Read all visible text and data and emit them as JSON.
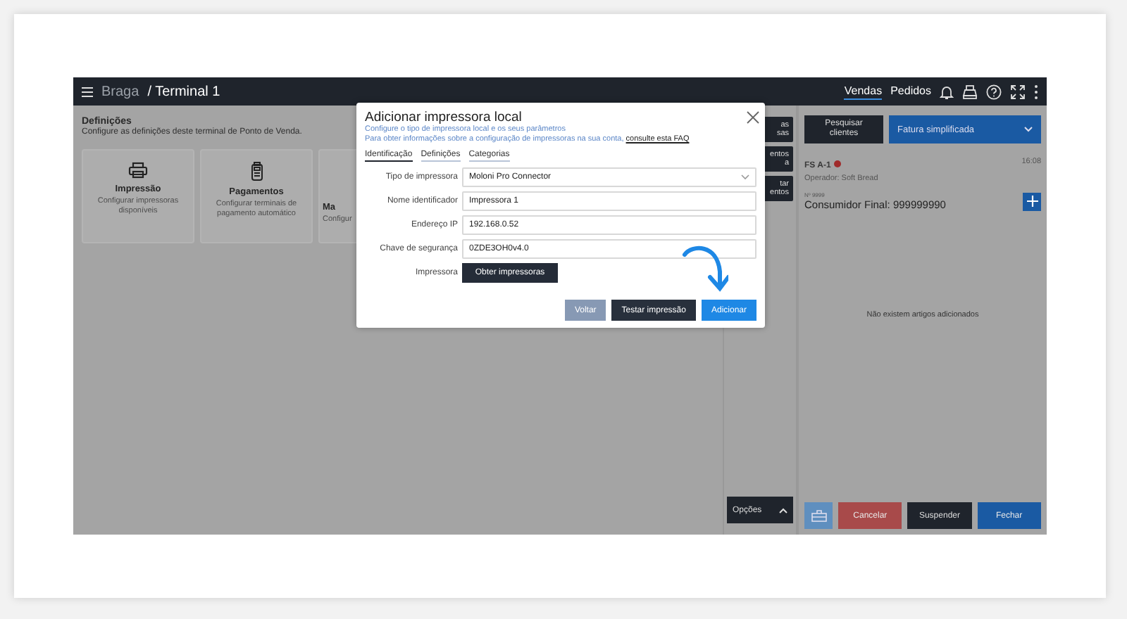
{
  "topbar": {
    "store": "Braga",
    "terminal": "/ Terminal 1",
    "nav": [
      {
        "label": "Vendas",
        "selected": true
      },
      {
        "label": "Pedidos",
        "selected": false
      }
    ]
  },
  "settings": {
    "title": "Definições",
    "subtitle": "Configure as definições deste terminal de Ponto de Venda.",
    "cards": [
      {
        "kind": "printer",
        "title": "Impressão",
        "text": "Configurar impressoras disponíveis"
      },
      {
        "kind": "payment",
        "title": "Pagamentos",
        "text": "Configurar terminais de pagamento automático"
      },
      {
        "kind": "partial",
        "title": "Ma",
        "text": "Configur"
      }
    ]
  },
  "side_buttons": [
    {
      "line1": "as",
      "line2": "sas"
    },
    {
      "line1": "entos",
      "line2": "a"
    },
    {
      "line1": "tar",
      "line2": "entos"
    }
  ],
  "options_button": "Opções",
  "sale": {
    "search_button": "Pesquisar clientes",
    "doc_type": "Fatura simplificada",
    "doc_number": "FS A-1",
    "time": "16:08",
    "operator": "Operador: Soft Bread",
    "nif_label": "Nº 9999",
    "customer": "Consumidor Final: 999999990",
    "empty": "Não existem artigos adicionados",
    "buttons": [
      {
        "kind": "drawer"
      },
      {
        "kind": "cancel",
        "label": "Cancelar"
      },
      {
        "kind": "dark",
        "label": "Suspender"
      },
      {
        "kind": "primary",
        "label": "Fechar"
      }
    ]
  },
  "modal": {
    "title": "Adicionar impressora local",
    "line1": "Configure o tipo de impressora local e os seus parâmetros",
    "line2": "Para obter informações sobre a configuração de impressoras na sua conta,",
    "link": "consulte esta FAQ",
    "tabs": [
      {
        "label": "Identificação",
        "selected": true
      },
      {
        "label": "Definições",
        "selected": false
      },
      {
        "label": "Categorias",
        "selected": false
      }
    ],
    "fields": [
      {
        "kind": "select",
        "label": "Tipo de impressora",
        "value": "Moloni Pro Connector"
      },
      {
        "kind": "text",
        "label": "Nome identificador",
        "value": "Impressora 1"
      },
      {
        "kind": "text",
        "label": "Endereço IP",
        "value": "192.168.0.52"
      },
      {
        "kind": "text",
        "label": "Chave de segurança",
        "value": "0ZDE3OH0v4.0"
      },
      {
        "kind": "button",
        "label": "Impressora",
        "value": "Obter impressoras"
      }
    ],
    "buttons": [
      {
        "kind": "muted",
        "label": "Voltar"
      },
      {
        "kind": "dark",
        "label": "Testar impressão"
      },
      {
        "kind": "primary",
        "label": "Adicionar"
      }
    ]
  }
}
